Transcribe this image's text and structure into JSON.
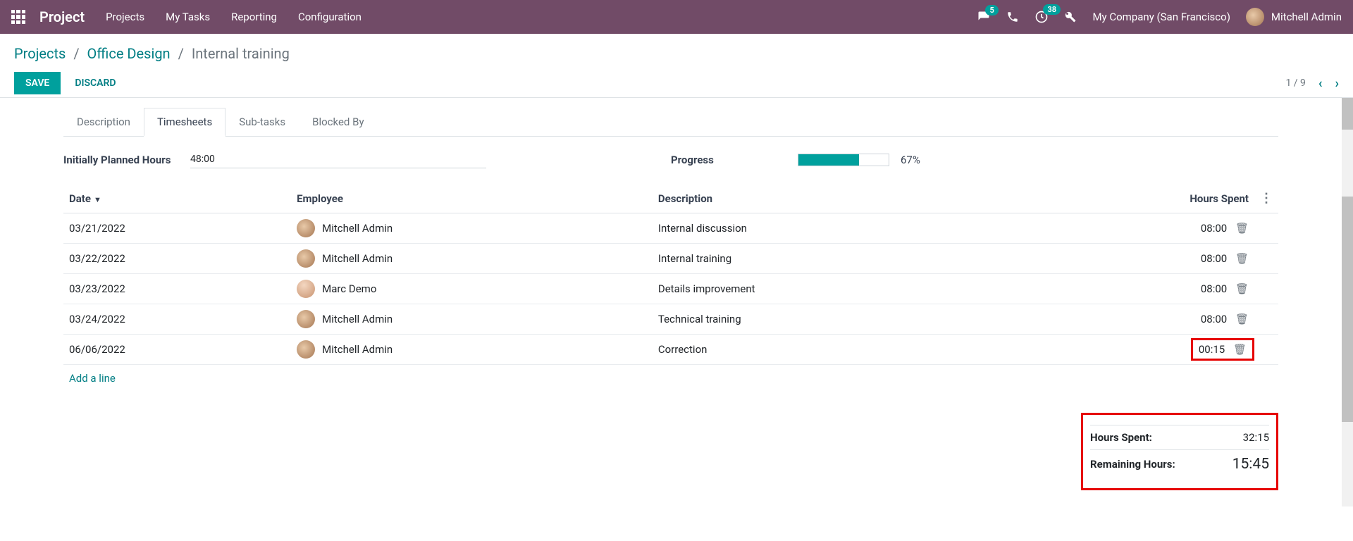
{
  "topbar": {
    "brand": "Project",
    "menu": [
      "Projects",
      "My Tasks",
      "Reporting",
      "Configuration"
    ],
    "messages_badge": "5",
    "activities_badge": "38",
    "company": "My Company (San Francisco)",
    "user": "Mitchell Admin"
  },
  "breadcrumb": {
    "root": "Projects",
    "project": "Office Design",
    "task": "Internal training"
  },
  "actions": {
    "save": "SAVE",
    "discard": "DISCARD",
    "pager": "1 / 9"
  },
  "tabs": [
    "Description",
    "Timesheets",
    "Sub-tasks",
    "Blocked By"
  ],
  "active_tab_index": 1,
  "planned": {
    "label": "Initially Planned Hours",
    "value": "48:00"
  },
  "progress": {
    "label": "Progress",
    "percent": 67,
    "display": "67%"
  },
  "columns": {
    "date": "Date",
    "employee": "Employee",
    "description": "Description",
    "hours": "Hours Spent"
  },
  "rows": [
    {
      "date": "03/21/2022",
      "employee": "Mitchell Admin",
      "avatar": "a1",
      "description": "Internal discussion",
      "hours": "08:00"
    },
    {
      "date": "03/22/2022",
      "employee": "Mitchell Admin",
      "avatar": "a1",
      "description": "Internal training",
      "hours": "08:00"
    },
    {
      "date": "03/23/2022",
      "employee": "Marc Demo",
      "avatar": "a2",
      "description": "Details improvement",
      "hours": "08:00"
    },
    {
      "date": "03/24/2022",
      "employee": "Mitchell Admin",
      "avatar": "a1",
      "description": "Technical training",
      "hours": "08:00"
    },
    {
      "date": "06/06/2022",
      "employee": "Mitchell Admin",
      "avatar": "a1",
      "description": "Correction",
      "hours": "00:15"
    }
  ],
  "add_line": "Add a line",
  "totals": {
    "spent_label": "Hours Spent:",
    "spent_value": "32:15",
    "remaining_label": "Remaining Hours:",
    "remaining_value": "15:45"
  }
}
